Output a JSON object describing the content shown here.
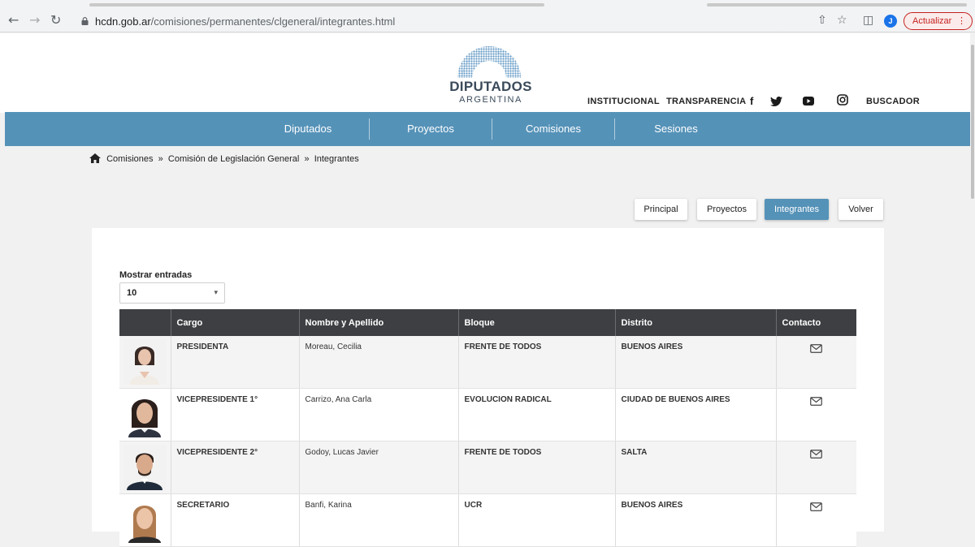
{
  "browser": {
    "url_host": "hcdn.gob.ar",
    "url_path": "/comisiones/permanentes/clgeneral/integrantes.html",
    "update_label": "Actualizar",
    "profile_initial": "J"
  },
  "header": {
    "logo_title": "DIPUTADOS",
    "logo_subtitle": "ARGENTINA",
    "links": [
      "INSTITUCIONAL",
      "TRANSPARENCIA",
      "BUSCADOR"
    ],
    "social_icons": [
      "facebook-icon",
      "twitter-icon",
      "youtube-icon",
      "instagram-icon"
    ]
  },
  "nav": {
    "items": [
      "Diputados",
      "Proyectos",
      "Comisiones",
      "Sesiones"
    ],
    "color": "#5592b8"
  },
  "breadcrumb": [
    "Comisiones",
    "Comisión de Legislación General",
    "Integrantes"
  ],
  "subtabs": {
    "items": [
      "Principal",
      "Proyectos",
      "Integrantes",
      "Volver"
    ],
    "active": "Integrantes"
  },
  "entries": {
    "label": "Mostrar entradas",
    "value": "10"
  },
  "table": {
    "headers": [
      "",
      "Cargo",
      "Nombre y Apellido",
      "Bloque",
      "Distrito",
      "Contacto"
    ],
    "rows": [
      {
        "cargo": "PRESIDENTA",
        "nombre": "Moreau, Cecilia",
        "bloque": "FRENTE DE TODOS",
        "distrito": "BUENOS AIRES"
      },
      {
        "cargo": "VICEPRESIDENTE 1°",
        "nombre": "Carrizo, Ana Carla",
        "bloque": "EVOLUCION RADICAL",
        "distrito": "CIUDAD DE BUENOS AIRES"
      },
      {
        "cargo": "VICEPRESIDENTE 2°",
        "nombre": "Godoy, Lucas Javier",
        "bloque": "FRENTE DE TODOS",
        "distrito": "SALTA"
      },
      {
        "cargo": "SECRETARIO",
        "nombre": "Banfi, Karina",
        "bloque": "UCR",
        "distrito": "BUENOS AIRES"
      }
    ]
  }
}
